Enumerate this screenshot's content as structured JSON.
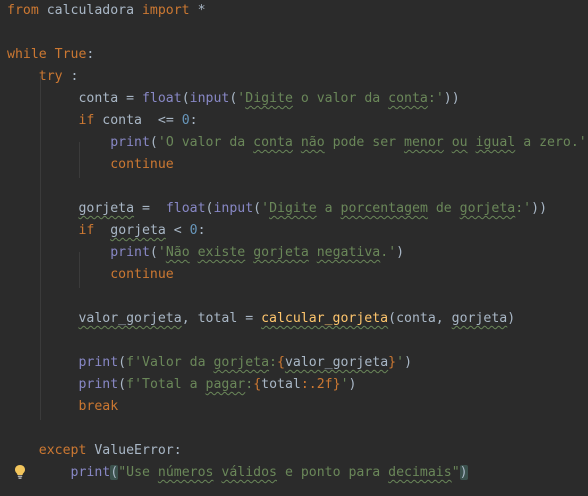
{
  "editor": {
    "lines": [
      [
        {
          "t": "from",
          "c": "kw"
        },
        {
          "t": " calculadora ",
          "c": "tx"
        },
        {
          "t": "import",
          "c": "kw"
        },
        {
          "t": " *",
          "c": "tx"
        }
      ],
      [],
      [
        {
          "t": "while",
          "c": "kw"
        },
        {
          "t": " ",
          "c": "tx"
        },
        {
          "t": "True",
          "c": "kw"
        },
        {
          "t": ":",
          "c": "tx"
        }
      ],
      [
        {
          "t": "    ",
          "c": "tx"
        },
        {
          "t": "try",
          "c": "kw"
        },
        {
          "t": " :",
          "c": "tx"
        }
      ],
      [
        {
          "t": "         conta = ",
          "c": "tx"
        },
        {
          "t": "float",
          "c": "bi"
        },
        {
          "t": "(",
          "c": "tx"
        },
        {
          "t": "input",
          "c": "bi"
        },
        {
          "t": "(",
          "c": "tx"
        },
        {
          "t": "'",
          "c": "str"
        },
        {
          "t": "Digite",
          "c": "str typo"
        },
        {
          "t": " o valor da ",
          "c": "str"
        },
        {
          "t": "conta",
          "c": "str typo"
        },
        {
          "t": ":'",
          "c": "str"
        },
        {
          "t": "))",
          "c": "tx"
        }
      ],
      [
        {
          "t": "         ",
          "c": "tx"
        },
        {
          "t": "if",
          "c": "kw"
        },
        {
          "t": " conta  <= ",
          "c": "tx"
        },
        {
          "t": "0",
          "c": "num"
        },
        {
          "t": ":",
          "c": "tx"
        }
      ],
      [
        {
          "t": "             ",
          "c": "tx"
        },
        {
          "t": "print",
          "c": "bi"
        },
        {
          "t": "(",
          "c": "tx"
        },
        {
          "t": "'O valor da ",
          "c": "str"
        },
        {
          "t": "conta",
          "c": "str typo"
        },
        {
          "t": " ",
          "c": "str"
        },
        {
          "t": "não",
          "c": "str typo"
        },
        {
          "t": " pode ser ",
          "c": "str"
        },
        {
          "t": "menor",
          "c": "str typo"
        },
        {
          "t": " ",
          "c": "str"
        },
        {
          "t": "ou",
          "c": "str typo"
        },
        {
          "t": " ",
          "c": "str"
        },
        {
          "t": "igual",
          "c": "str typo"
        },
        {
          "t": " a zero.'",
          "c": "str"
        },
        {
          "t": ")",
          "c": "tx"
        }
      ],
      [
        {
          "t": "             ",
          "c": "tx"
        },
        {
          "t": "continue",
          "c": "kw"
        }
      ],
      [],
      [
        {
          "t": "         ",
          "c": "tx"
        },
        {
          "t": "gorjeta",
          "c": "tx typo"
        },
        {
          "t": " =  ",
          "c": "tx"
        },
        {
          "t": "float",
          "c": "bi"
        },
        {
          "t": "(",
          "c": "tx"
        },
        {
          "t": "input",
          "c": "bi"
        },
        {
          "t": "(",
          "c": "tx"
        },
        {
          "t": "'",
          "c": "str"
        },
        {
          "t": "Digite",
          "c": "str typo"
        },
        {
          "t": " a ",
          "c": "str"
        },
        {
          "t": "porcentagem",
          "c": "str typo"
        },
        {
          "t": " de ",
          "c": "str"
        },
        {
          "t": "gorjeta",
          "c": "str typo"
        },
        {
          "t": ":'",
          "c": "str"
        },
        {
          "t": "))",
          "c": "tx"
        }
      ],
      [
        {
          "t": "         ",
          "c": "tx"
        },
        {
          "t": "if",
          "c": "kw"
        },
        {
          "t": "  ",
          "c": "tx"
        },
        {
          "t": "gorjeta",
          "c": "tx typo"
        },
        {
          "t": " < ",
          "c": "tx"
        },
        {
          "t": "0",
          "c": "num"
        },
        {
          "t": ":",
          "c": "tx"
        }
      ],
      [
        {
          "t": "             ",
          "c": "tx"
        },
        {
          "t": "print",
          "c": "bi"
        },
        {
          "t": "(",
          "c": "tx"
        },
        {
          "t": "'",
          "c": "str"
        },
        {
          "t": "Não",
          "c": "str typo"
        },
        {
          "t": " ",
          "c": "str"
        },
        {
          "t": "existe",
          "c": "str typo"
        },
        {
          "t": " ",
          "c": "str"
        },
        {
          "t": "gorjeta",
          "c": "str typo"
        },
        {
          "t": " ",
          "c": "str"
        },
        {
          "t": "negativa",
          "c": "str typo"
        },
        {
          "t": ".'",
          "c": "str"
        },
        {
          "t": ")",
          "c": "tx"
        }
      ],
      [
        {
          "t": "             ",
          "c": "tx"
        },
        {
          "t": "continue",
          "c": "kw"
        }
      ],
      [],
      [
        {
          "t": "         ",
          "c": "tx"
        },
        {
          "t": "valor_gorjeta",
          "c": "tx typo"
        },
        {
          "t": ", total = ",
          "c": "tx"
        },
        {
          "t": "calcular_gorjeta",
          "c": "fn typo"
        },
        {
          "t": "(conta, ",
          "c": "tx"
        },
        {
          "t": "gorjeta",
          "c": "tx typo"
        },
        {
          "t": ")",
          "c": "tx"
        }
      ],
      [],
      [
        {
          "t": "         ",
          "c": "tx"
        },
        {
          "t": "print",
          "c": "bi"
        },
        {
          "t": "(",
          "c": "tx"
        },
        {
          "t": "f'Valor da ",
          "c": "str"
        },
        {
          "t": "gorjeta",
          "c": "str typo"
        },
        {
          "t": ":",
          "c": "str"
        },
        {
          "t": "{",
          "c": "kw"
        },
        {
          "t": "valor_gorjeta",
          "c": "tx typo"
        },
        {
          "t": "}",
          "c": "kw"
        },
        {
          "t": "'",
          "c": "str"
        },
        {
          "t": ")",
          "c": "tx"
        }
      ],
      [
        {
          "t": "         ",
          "c": "tx"
        },
        {
          "t": "print",
          "c": "bi"
        },
        {
          "t": "(",
          "c": "tx"
        },
        {
          "t": "f'Total a ",
          "c": "str"
        },
        {
          "t": "pagar",
          "c": "str typo"
        },
        {
          "t": ":",
          "c": "str"
        },
        {
          "t": "{",
          "c": "kw"
        },
        {
          "t": "total",
          "c": "tx"
        },
        {
          "t": ":.2f",
          "c": "kw"
        },
        {
          "t": "}",
          "c": "kw"
        },
        {
          "t": "'",
          "c": "str"
        },
        {
          "t": ")",
          "c": "tx"
        }
      ],
      [
        {
          "t": "         ",
          "c": "tx"
        },
        {
          "t": "break",
          "c": "kw"
        }
      ],
      [],
      [
        {
          "t": "    ",
          "c": "tx"
        },
        {
          "t": "except",
          "c": "kw"
        },
        {
          "t": " ValueError:",
          "c": "tx"
        }
      ],
      [
        {
          "t": "        ",
          "c": "tx"
        },
        {
          "t": "print",
          "c": "bi"
        },
        {
          "t": "(",
          "c": "tx hl"
        },
        {
          "t": "\"Use ",
          "c": "str"
        },
        {
          "t": "números",
          "c": "str typo"
        },
        {
          "t": " ",
          "c": "str"
        },
        {
          "t": "válidos",
          "c": "str typo"
        },
        {
          "t": " e ponto para ",
          "c": "str"
        },
        {
          "t": "decimais",
          "c": "str typo"
        },
        {
          "t": "\"",
          "c": "str"
        },
        {
          "t": ")",
          "c": "tx hl"
        }
      ]
    ]
  },
  "icons": {
    "intention": "lightbulb-icon"
  },
  "colors": {
    "background": "#2b2b2b",
    "keyword": "#cc7832",
    "builtin": "#8888c6",
    "function": "#ffc66d",
    "string": "#6a8759",
    "number": "#6897bb",
    "text": "#a9b7c6"
  }
}
